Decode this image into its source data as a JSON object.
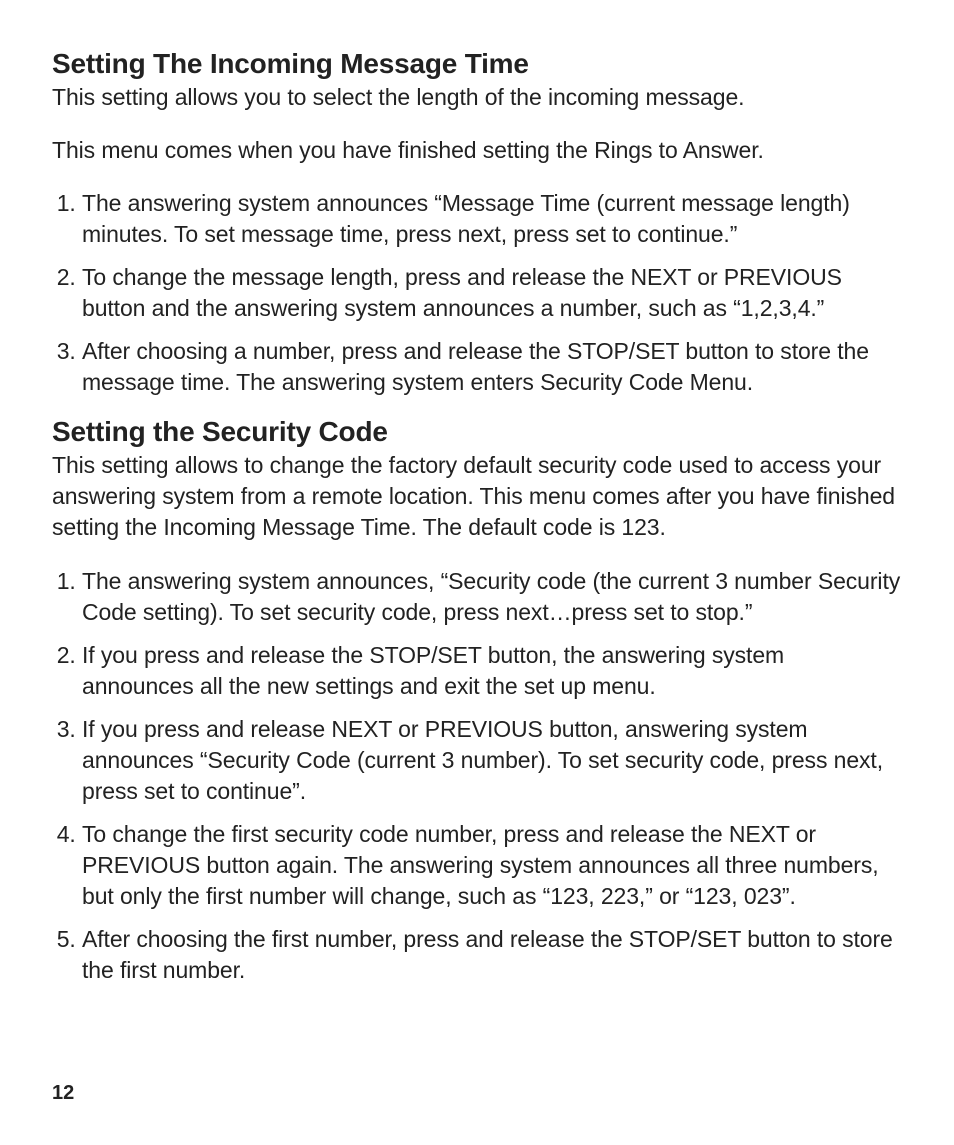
{
  "section1": {
    "heading": "Setting The Incoming Message Time",
    "para1": "This setting allows you to select the length of the incoming message.",
    "para2": "This menu comes when you have finished setting the Rings to Answer.",
    "list": [
      "The answering system announces “Message Time (current message length) minutes. To set message time, press next, press set to continue.”",
      "To change the message length, press and release the NEXT or PREVIOUS button and the answering system announces a number, such as “1,2,3,4.”",
      "After choosing a number, press and release the STOP/SET button to store the message time. The answering system enters Security Code Menu."
    ]
  },
  "section2": {
    "heading": "Setting the Security Code",
    "para1": "This setting allows to change the factory default security code used to access your answering system from a remote location. This menu comes after you have finished setting the Incoming Message Time. The default code is 123.",
    "list": [
      "The answering system announces, “Security code  (the current 3 number Security Code setting). To set security code, press next…press set to stop.”",
      "If you press and release the STOP/SET button, the answering system announces all the new settings and exit the set up menu.",
      "If you press and release NEXT or PREVIOUS button, answering system announces “Security Code (current 3 number). To set security code, press next, press set to continue”.",
      "To change the first security code number, press and release the NEXT or PREVIOUS button again. The answering system announces all three numbers, but only the first number will change, such as “123, 223,” or “123, 023”.",
      "After choosing the first number, press and release the STOP/SET button to store the first number."
    ]
  },
  "pageNumber": "12"
}
